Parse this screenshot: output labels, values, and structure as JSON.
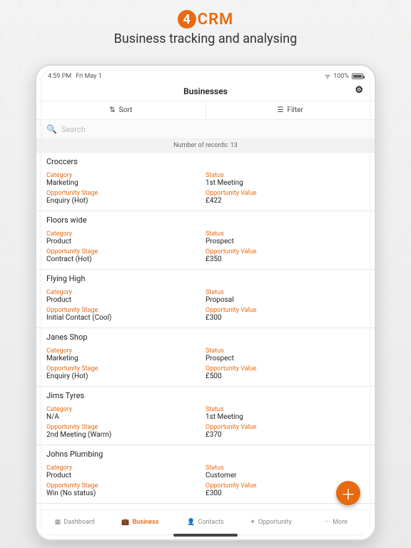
{
  "brand": {
    "circle": "4",
    "text": "CRM"
  },
  "tagline": "Business tracking and analysing",
  "status": {
    "time": "4:59 PM",
    "date": "Fri May 1",
    "signal": "✓",
    "battery_pct": "100%"
  },
  "nav_title": "Businesses",
  "toolbar": {
    "sort": "Sort",
    "filter": "Filter"
  },
  "search": {
    "placeholder": "Search"
  },
  "record_count_label": "Number of records: 13",
  "labels": {
    "category": "Category",
    "status": "Status",
    "stage": "Opportunity Stage",
    "value": "Opportunity Value"
  },
  "records": [
    {
      "name": "Croccers",
      "category": "Marketing",
      "status": "1st Meeting",
      "stage": "Enquiry (Hot)",
      "value": "£422"
    },
    {
      "name": "Floors wide",
      "category": "Product",
      "status": "Prospect",
      "stage": "Contract (Hot)",
      "value": "£350"
    },
    {
      "name": "Flying High",
      "category": "Product",
      "status": "Proposal",
      "stage": "Initial Contact (Cool)",
      "value": "£300"
    },
    {
      "name": "Janes Shop",
      "category": "Marketing",
      "status": "Prospect",
      "stage": "Enquiry (Hot)",
      "value": "£500"
    },
    {
      "name": "Jims Tyres",
      "category": "N/A",
      "status": "1st Meeting",
      "stage": "2nd Meeting (Warm)",
      "value": "£370"
    },
    {
      "name": "Johns Plumbing",
      "category": "Product",
      "status": "Customer",
      "stage": "Win (No status)",
      "value": "£300"
    }
  ],
  "tabs": {
    "dashboard": "Dashboard",
    "business": "Business",
    "contacts": "Contacts",
    "opportunity": "Opportunity",
    "more": "More"
  }
}
